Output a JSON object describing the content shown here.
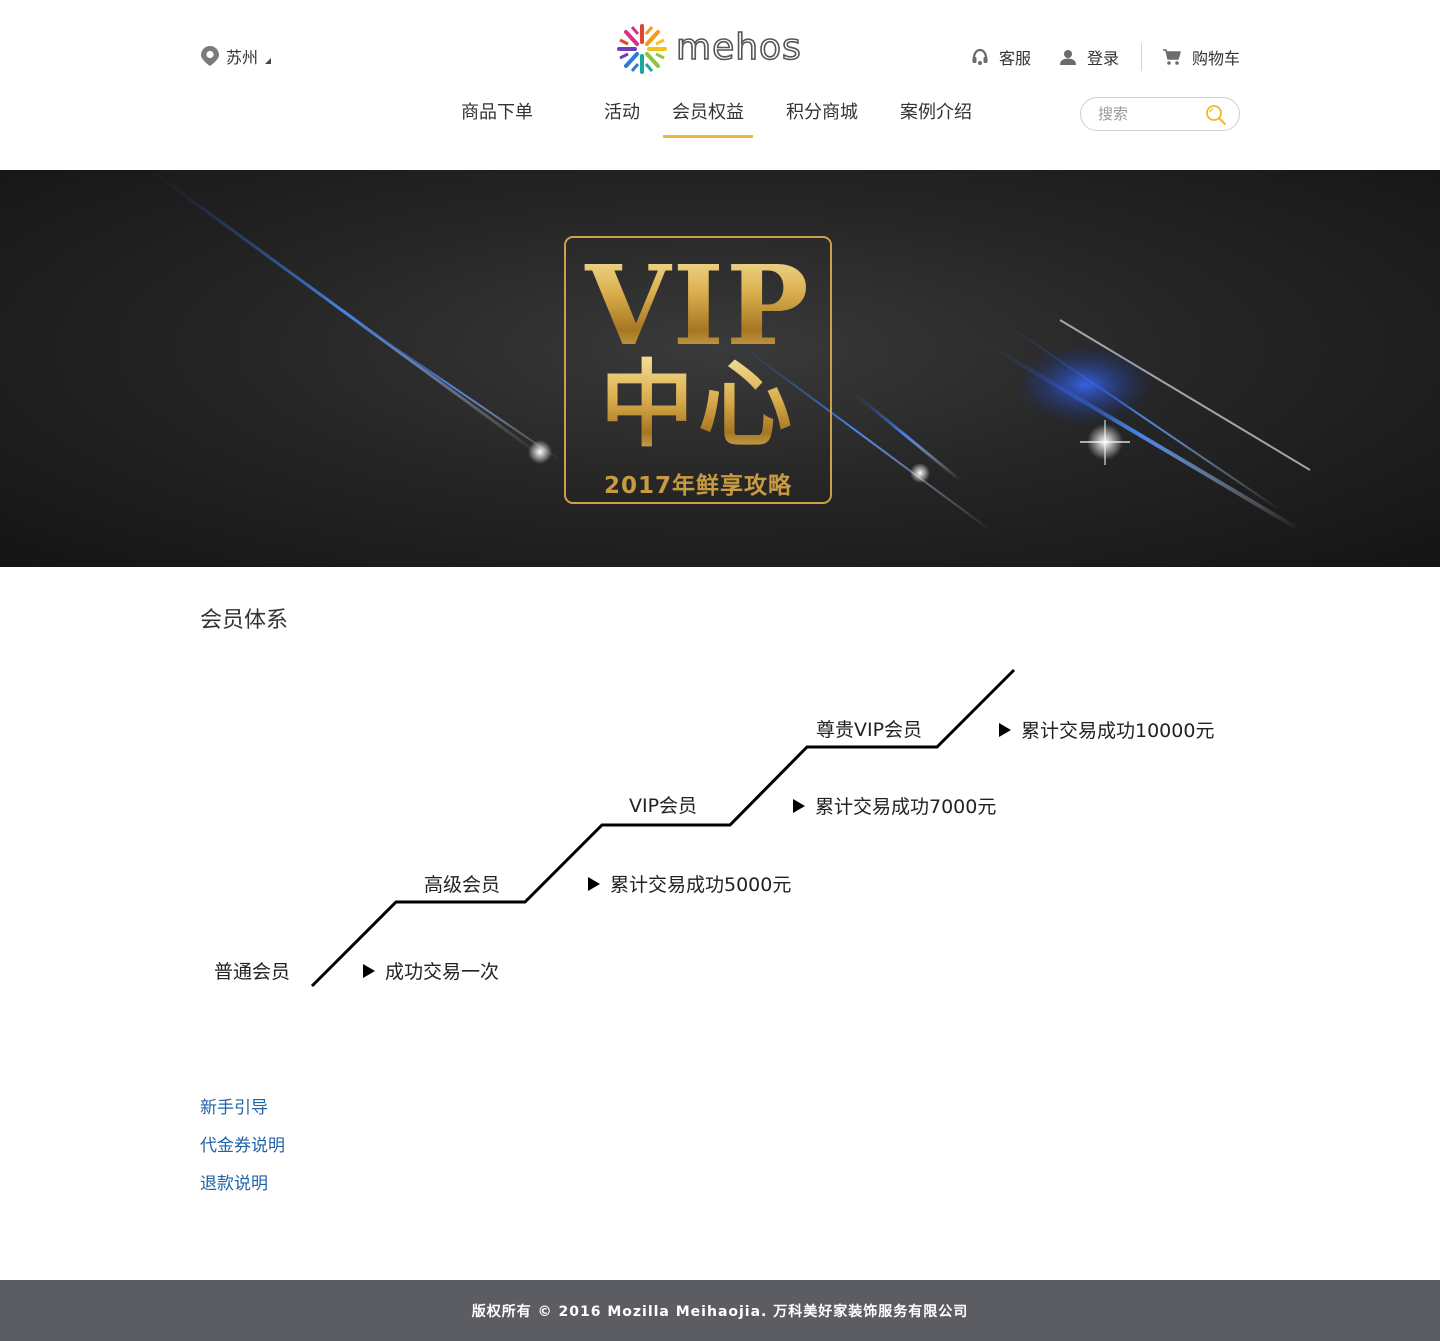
{
  "header": {
    "location": "苏州",
    "logo_text": "mehos",
    "links": {
      "service": "客服",
      "login": "登录",
      "cart": "购物车"
    },
    "nav": [
      {
        "label": "商品下单"
      },
      {
        "label": "活动"
      },
      {
        "label": "会员权益"
      },
      {
        "label": "积分商城"
      },
      {
        "label": "案例介绍"
      }
    ],
    "active_nav": "会员权益",
    "search_placeholder": "搜索",
    "accent_color": "#f1b72e"
  },
  "banner": {
    "title_en": "VIP",
    "title_cn": "中心",
    "subtitle": "2017年鲜享攻略",
    "gold_color": "#c9a24a"
  },
  "member_system": {
    "title": "会员体系",
    "levels": [
      {
        "name": "普通会员",
        "condition": "成功交易一次"
      },
      {
        "name": "高级会员",
        "condition": "累计交易成功5000元"
      },
      {
        "name": "VIP会员",
        "condition": "累计交易成功7000元"
      },
      {
        "name": "尊贵VIP会员",
        "condition": "累计交易成功10000元"
      }
    ]
  },
  "help_links": [
    "新手引导",
    "代金券说明",
    "退款说明"
  ],
  "footer": {
    "copyright": "版权所有 © 2016 Mozilla Meihaojia. 万科美好家装饰服务有限公司"
  }
}
